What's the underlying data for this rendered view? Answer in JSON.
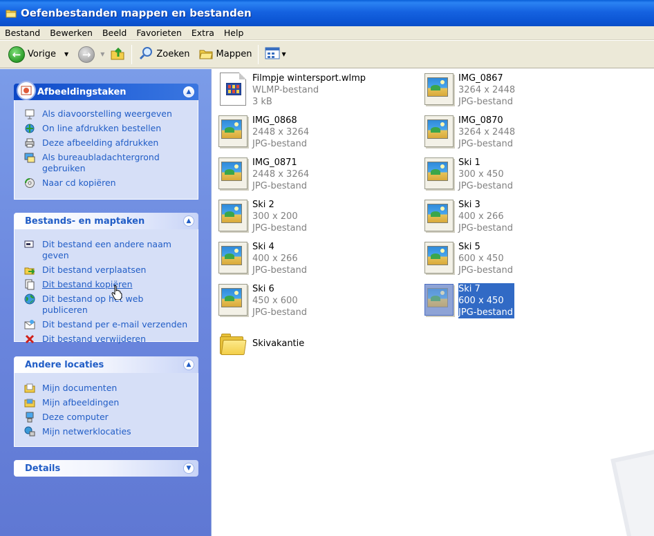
{
  "window": {
    "title": "Oefenbestanden mappen en bestanden"
  },
  "menu": [
    "Bestand",
    "Bewerken",
    "Beeld",
    "Favorieten",
    "Extra",
    "Help"
  ],
  "toolbar": {
    "back_label": "Vorige",
    "search_label": "Zoeken",
    "folders_label": "Mappen"
  },
  "panels": {
    "picture_tasks": {
      "title": "Afbeeldingstaken",
      "items": [
        {
          "label": "Als diavoorstelling weergeven",
          "icon": "slideshow-icon"
        },
        {
          "label": "On line afdrukken bestellen",
          "icon": "online-print-icon"
        },
        {
          "label": "Deze afbeelding afdrukken",
          "icon": "printer-icon"
        },
        {
          "label": "Als bureaubladachtergrond gebruiken",
          "icon": "desktop-background-icon"
        },
        {
          "label": "Naar cd kopiëren",
          "icon": "cd-icon"
        }
      ]
    },
    "file_tasks": {
      "title": "Bestands- en maptaken",
      "items": [
        {
          "label": "Dit bestand een andere naam geven",
          "icon": "rename-icon"
        },
        {
          "label": "Dit bestand verplaatsen",
          "icon": "move-icon"
        },
        {
          "label": "Dit bestand kopiëren",
          "icon": "copy-icon"
        },
        {
          "label": "Dit bestand op het web publiceren",
          "icon": "globe-icon"
        },
        {
          "label": "Dit bestand per e-mail verzenden",
          "icon": "email-icon"
        },
        {
          "label": "Dit bestand verwijderen",
          "icon": "delete-x-icon"
        }
      ]
    },
    "other_places": {
      "title": "Andere locaties",
      "items": [
        {
          "label": "Mijn documenten",
          "icon": "my-documents-icon"
        },
        {
          "label": "Mijn afbeeldingen",
          "icon": "my-pictures-icon"
        },
        {
          "label": "Deze computer",
          "icon": "my-computer-icon"
        },
        {
          "label": "Mijn netwerklocaties",
          "icon": "network-places-icon"
        }
      ]
    },
    "details": {
      "title": "Details"
    }
  },
  "files": [
    {
      "name": "Filmpje wintersport.wlmp",
      "line2": "WLMP-bestand",
      "line3": "3 kB",
      "kind": "wlmp"
    },
    {
      "name": "IMG_0867",
      "line2": "3264 x 2448",
      "line3": "JPG-bestand",
      "kind": "image"
    },
    {
      "name": "IMG_0868",
      "line2": "2448 x 3264",
      "line3": "JPG-bestand",
      "kind": "image"
    },
    {
      "name": "IMG_0870",
      "line2": "3264 x 2448",
      "line3": "JPG-bestand",
      "kind": "image"
    },
    {
      "name": "IMG_0871",
      "line2": "2448 x 3264",
      "line3": "JPG-bestand",
      "kind": "image"
    },
    {
      "name": "Ski 1",
      "line2": "300 x 450",
      "line3": "JPG-bestand",
      "kind": "image"
    },
    {
      "name": "Ski 2",
      "line2": "300 x 200",
      "line3": "JPG-bestand",
      "kind": "image"
    },
    {
      "name": "Ski 3",
      "line2": "400 x 266",
      "line3": "JPG-bestand",
      "kind": "image"
    },
    {
      "name": "Ski 4",
      "line2": "400 x 266",
      "line3": "JPG-bestand",
      "kind": "image"
    },
    {
      "name": "Ski 5",
      "line2": "600 x 450",
      "line3": "JPG-bestand",
      "kind": "image"
    },
    {
      "name": "Ski 6",
      "line2": "450 x 600",
      "line3": "JPG-bestand",
      "kind": "image"
    },
    {
      "name": "Ski 7",
      "line2": "600 x 450",
      "line3": "JPG-bestand",
      "kind": "image",
      "selected": true
    },
    {
      "name": "Skivakantie",
      "kind": "folder"
    }
  ]
}
